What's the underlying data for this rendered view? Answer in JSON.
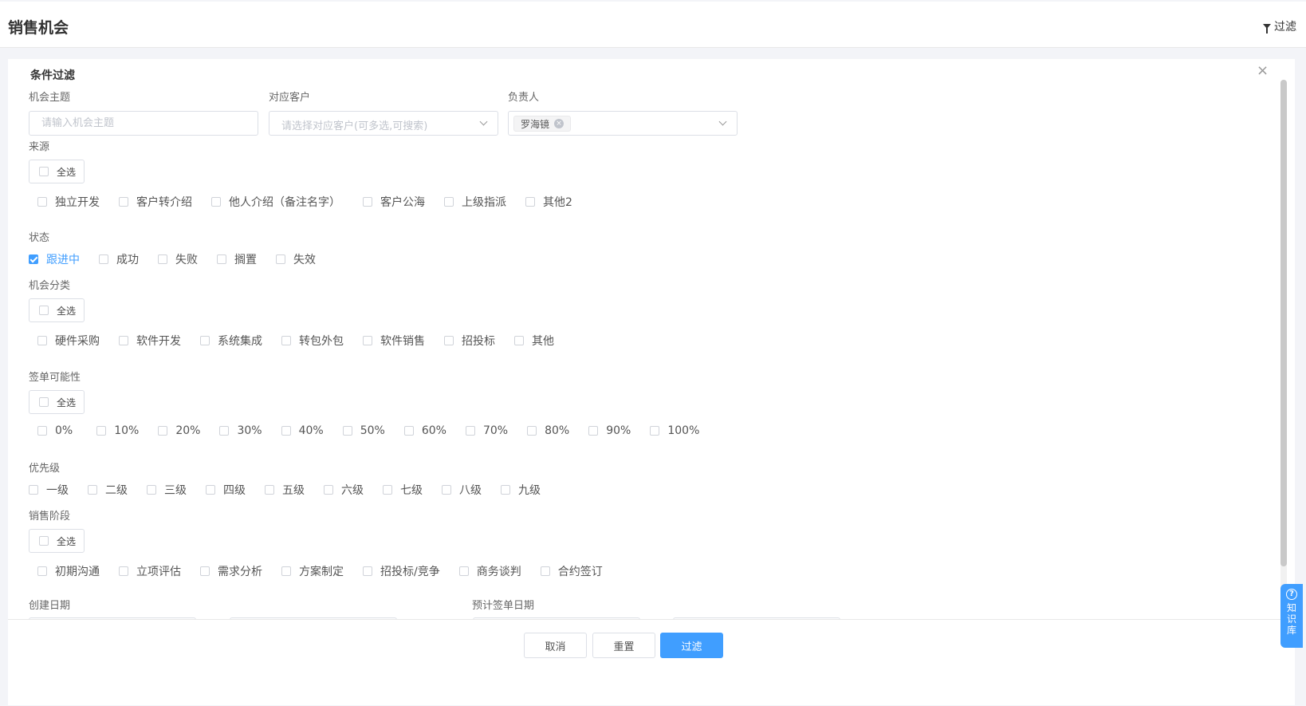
{
  "page": {
    "title": "销售机会",
    "filter_link": "过滤"
  },
  "panel": {
    "title": "条件过滤",
    "close": "×"
  },
  "fields": {
    "topic": {
      "label": "机会主题",
      "placeholder": "请输入机会主题"
    },
    "customer": {
      "label": "对应客户",
      "placeholder": "请选择对应客户(可多选,可搜索)"
    },
    "owner": {
      "label": "负责人",
      "tag": "罗海镜",
      "tag_close": "×"
    }
  },
  "source": {
    "label": "来源",
    "select_all": "全选",
    "options": [
      "独立开发",
      "客户转介绍",
      "他人介绍（备注名字）",
      "客户公海",
      "上级指派",
      "其他2"
    ]
  },
  "status": {
    "label": "状态",
    "options": [
      {
        "label": "跟进中",
        "checked": true
      },
      {
        "label": "成功",
        "checked": false
      },
      {
        "label": "失败",
        "checked": false
      },
      {
        "label": "搁置",
        "checked": false
      },
      {
        "label": "失效",
        "checked": false
      }
    ]
  },
  "category": {
    "label": "机会分类",
    "select_all": "全选",
    "options": [
      "硬件采购",
      "软件开发",
      "系统集成",
      "转包外包",
      "软件销售",
      "招投标",
      "其他"
    ]
  },
  "probability": {
    "label": "签单可能性",
    "select_all": "全选",
    "options": [
      "0%",
      "10%",
      "20%",
      "30%",
      "40%",
      "50%",
      "60%",
      "70%",
      "80%",
      "90%",
      "100%"
    ]
  },
  "priority": {
    "label": "优先级",
    "options": [
      "一级",
      "二级",
      "三级",
      "四级",
      "五级",
      "六级",
      "七级",
      "八级",
      "九级"
    ]
  },
  "stage": {
    "label": "销售阶段",
    "select_all": "全选",
    "options": [
      "初期沟通",
      "立项评估",
      "需求分析",
      "方案制定",
      "招投标/竞争",
      "商务谈判",
      "合约签订"
    ]
  },
  "dates": {
    "created_label": "创建日期",
    "expected_label": "预计签单日期"
  },
  "footer": {
    "cancel": "取消",
    "reset": "重置",
    "filter": "过滤"
  },
  "kb_widget": {
    "icon": "?",
    "chars": [
      "知",
      "识",
      "库"
    ]
  },
  "colors": {
    "accent": "#409eff",
    "border": "#dcdfe6"
  }
}
